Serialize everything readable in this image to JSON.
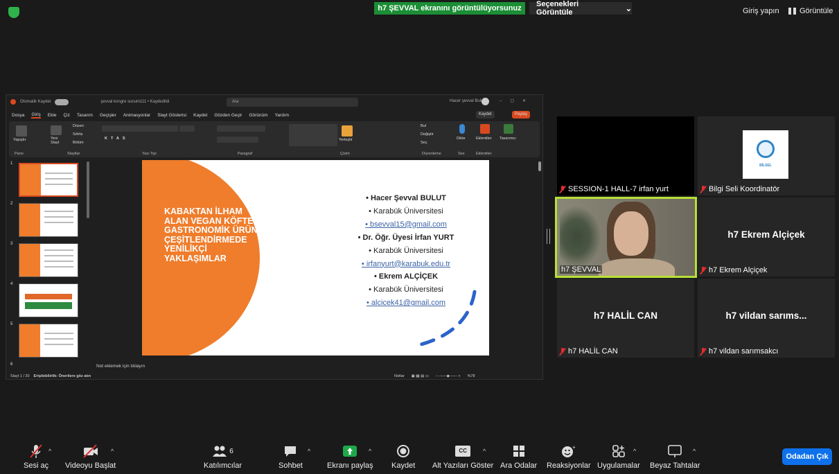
{
  "topbar": {
    "share_banner": "h7 ŞEVVAL ekranını görüntülüyorsunuz",
    "view_options": "Seçenekleri Görüntüle",
    "signin": "Giriş yapın",
    "view": "Görüntüle"
  },
  "ppt": {
    "title_autosave": "Otomatik Kaydet",
    "file_name": "şevval kongre sunum111 • Kaydedildi",
    "search": "Ara",
    "user": "Hacer şevval Bulut",
    "menu": [
      "Dosya",
      "Giriş",
      "Ekle",
      "Çiz",
      "Tasarım",
      "Geçişler",
      "Animasyonlar",
      "Slayt Gösterisi",
      "Kaydet",
      "Gözden Geçir",
      "Görünüm",
      "Yardım"
    ],
    "kaydet": "Kaydet",
    "paylas": "Paylaş",
    "ribbon_groups": [
      "Pano",
      "Slaytlar",
      "Yazı Tipi",
      "Paragraf",
      "Çizim",
      "Düzenleme",
      "Ses",
      "Eklentiler"
    ],
    "ribbon_buttons": {
      "yapistir": "Yapıştır",
      "yeni_slayt": "Yeni Slayt",
      "duzen": "Düzen",
      "sifirla": "Sıfırla",
      "bolum": "Bölüm",
      "yerlestir": "Yerleştir",
      "bul": "Bul",
      "degistir": "Değiştir",
      "sec": "Seç",
      "dikte": "Dikte",
      "eklentiler": "Eklentiler",
      "tasarimci": "Tasarımcı"
    },
    "thumb_numbers": [
      "1",
      "2",
      "3",
      "4",
      "5",
      "6"
    ],
    "slide": {
      "title": "KABAKTAN İLHAM ALAN VEGAN KÖFTE: GASTRONOMİK ÜRÜN ÇEŞİTLENDİRMEDE YENİLİKÇİ YAKLAŞIMLAR",
      "items": [
        "• Hacer Şevval BULUT",
        "• Karabük Üniversitesi",
        "• bsevval15@gmail.com",
        "• Dr. Öğr. Üyesi İrfan YURT",
        "• Karabük Üniversitesi",
        "• irfanyurt@karabuk.edu.tr",
        "• Ekrem ALÇİÇEK",
        "• Karabük Üniversitesi",
        "• alcicek41@gmail.com"
      ]
    },
    "notes": "Not eklemek için tıklayın",
    "status_slide": "Slayt 1 / 20",
    "status_access": "Erişilebilirlik: Önerilere göz atın",
    "status_notes": "Notlar",
    "zoom": "%78"
  },
  "participants": [
    {
      "name": "SESSION-1 HALL-7 irfan yurt",
      "big": ""
    },
    {
      "name": "Bilgi Seli Koordinatör",
      "big": "",
      "logo": "BİLSEL"
    },
    {
      "name": "h7 ŞEVVAL",
      "big": ""
    },
    {
      "name": "h7 Ekrem Alçiçek",
      "big": "h7 Ekrem Alçiçek"
    },
    {
      "name": "h7 HALİL CAN",
      "big": "h7 HALİL CAN"
    },
    {
      "name": "h7 vildan sarımsakcı",
      "big": "h7 vildan sarıms..."
    }
  ],
  "toolbar": {
    "audio": "Sesi aç",
    "video": "Videoyu Başlat",
    "participants": "Katılımcılar",
    "participant_count": "6",
    "chat": "Sohbet",
    "share": "Ekranı paylaş",
    "record": "Kaydet",
    "captions": "Alt Yazıları Göster",
    "breakout": "Ara Odalar",
    "reactions": "Reaksiyonlar",
    "apps": "Uygulamalar",
    "whiteboard": "Beyaz Tahtalar",
    "leave": "Odadan Çık",
    "cc_icon_label": "CC"
  },
  "colors": {
    "accent_orange": "#ef7d2c",
    "share_green": "#1b8e36",
    "leave_blue": "#0e71eb",
    "active_speaker": "#b8e036"
  }
}
